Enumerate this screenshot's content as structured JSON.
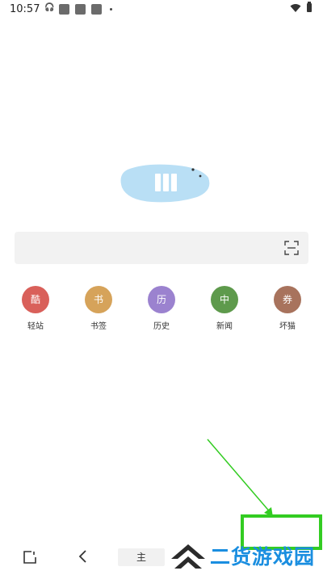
{
  "status_bar": {
    "time": "10:57",
    "icons": [
      "headset-icon",
      "app-icon",
      "app-icon",
      "app-icon",
      "notification-dot",
      "wifi-icon",
      "battery-icon"
    ]
  },
  "logo": {
    "icon": "browser-logo-blob",
    "color": "#b9dff5"
  },
  "search": {
    "placeholder": "",
    "scan_icon": "scan-icon"
  },
  "shortcuts": [
    {
      "glyph": "酷",
      "label": "轻站",
      "color": "#d9605a"
    },
    {
      "glyph": "书",
      "label": "书签",
      "color": "#d6a35a"
    },
    {
      "glyph": "历",
      "label": "历史",
      "color": "#9b82cf"
    },
    {
      "glyph": "中",
      "label": "新闻",
      "color": "#5e9a4c"
    },
    {
      "glyph": "券",
      "label": "坏猫",
      "color": "#a8735d"
    }
  ],
  "bottom_nav": {
    "pages_icon": "tabs-icon",
    "back_icon": "back-icon",
    "home_label": "主"
  },
  "annotation": {
    "color": "#33cc22"
  },
  "watermark": {
    "text": "二货游戏园",
    "color": "#1a8ee0"
  }
}
